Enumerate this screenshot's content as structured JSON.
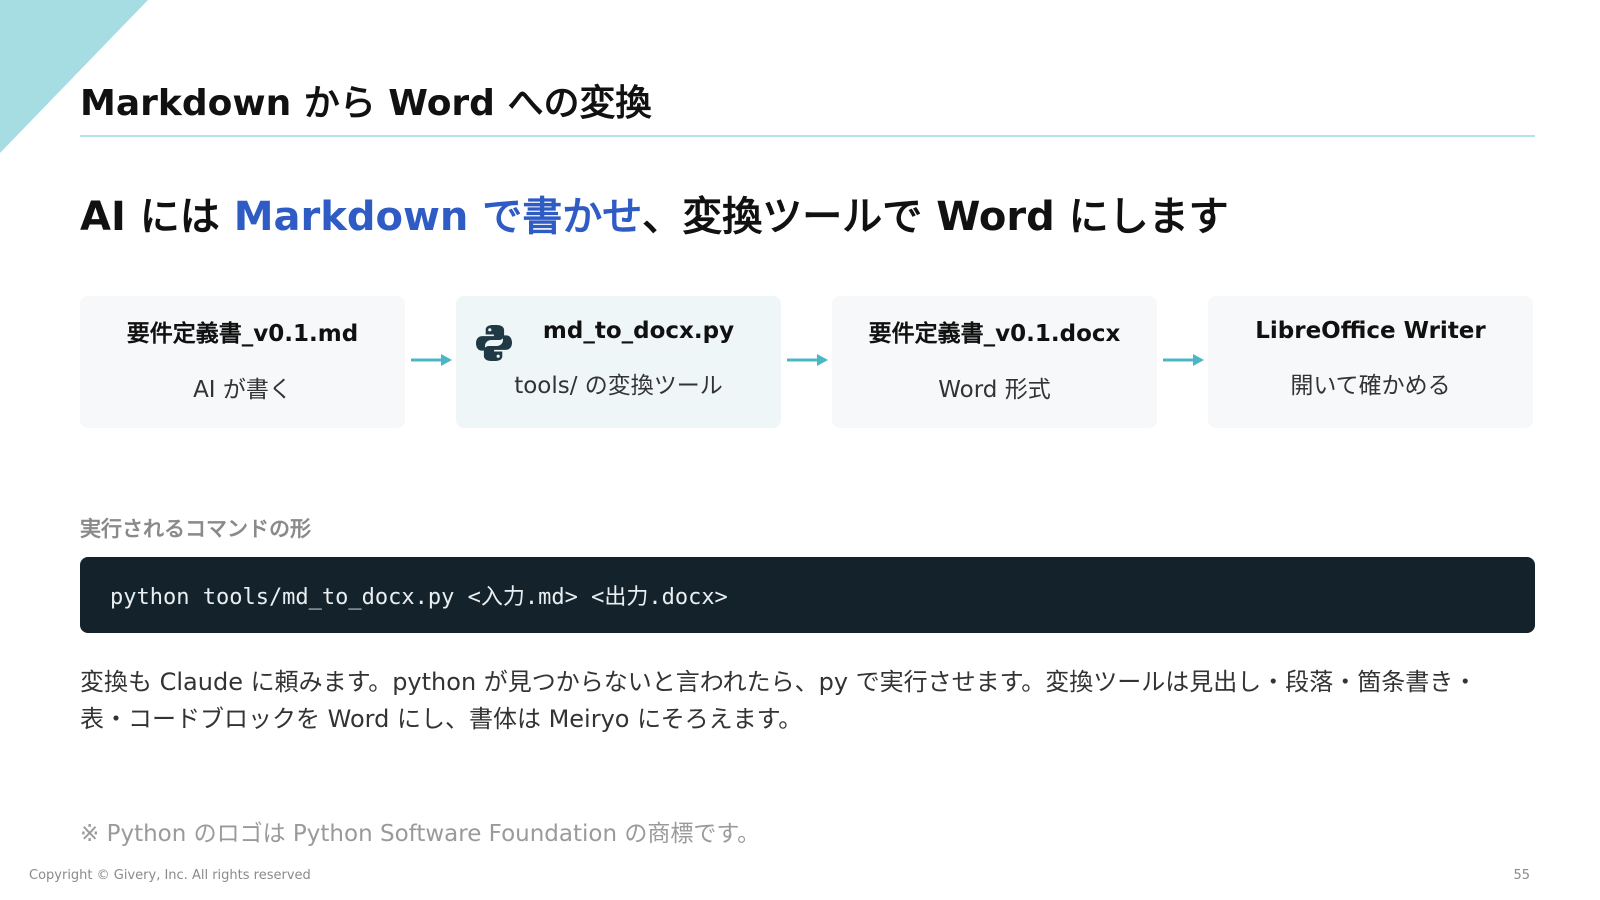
{
  "slide": {
    "title": "Markdown から Word への変換",
    "headline": {
      "prefix": "AI には ",
      "accent": "Markdown で書かせ",
      "suffix": "、変換ツールで Word にします"
    }
  },
  "flow": {
    "steps": [
      {
        "title": "要件定義書_v0.1.md",
        "subtitle": "AI が書く"
      },
      {
        "title": "md_to_docx.py",
        "subtitle": "tools/ の変換ツール",
        "icon": "python-logo-icon"
      },
      {
        "title": "要件定義書_v0.1.docx",
        "subtitle": "Word 形式"
      },
      {
        "title": "LibreOffice Writer",
        "subtitle": "開いて確かめる"
      }
    ]
  },
  "command": {
    "label": "実行されるコマンドの形",
    "code": "python tools/md_to_docx.py <入力.md> <出力.docx>"
  },
  "body": {
    "paragraph": "変換も Claude に頼みます。python が見つからないと言われたら、py で実行させます。変換ツールは見出し・段落・箇条書き・表・コードブロックを Word にし、書体は Meiryo にそろえます。"
  },
  "footnote": "※ Python のロゴは Python Software Foundation の商標です。",
  "footer": {
    "copyright": "Copyright © Givery, Inc. All rights reserved",
    "page_number": "55"
  },
  "colors": {
    "accent_blue": "#2f5bc4",
    "arrow_teal": "#4bb7c4",
    "code_bg": "#14232b",
    "corner_teal": "#a6dde3",
    "python_icon": "#1f3a45"
  }
}
